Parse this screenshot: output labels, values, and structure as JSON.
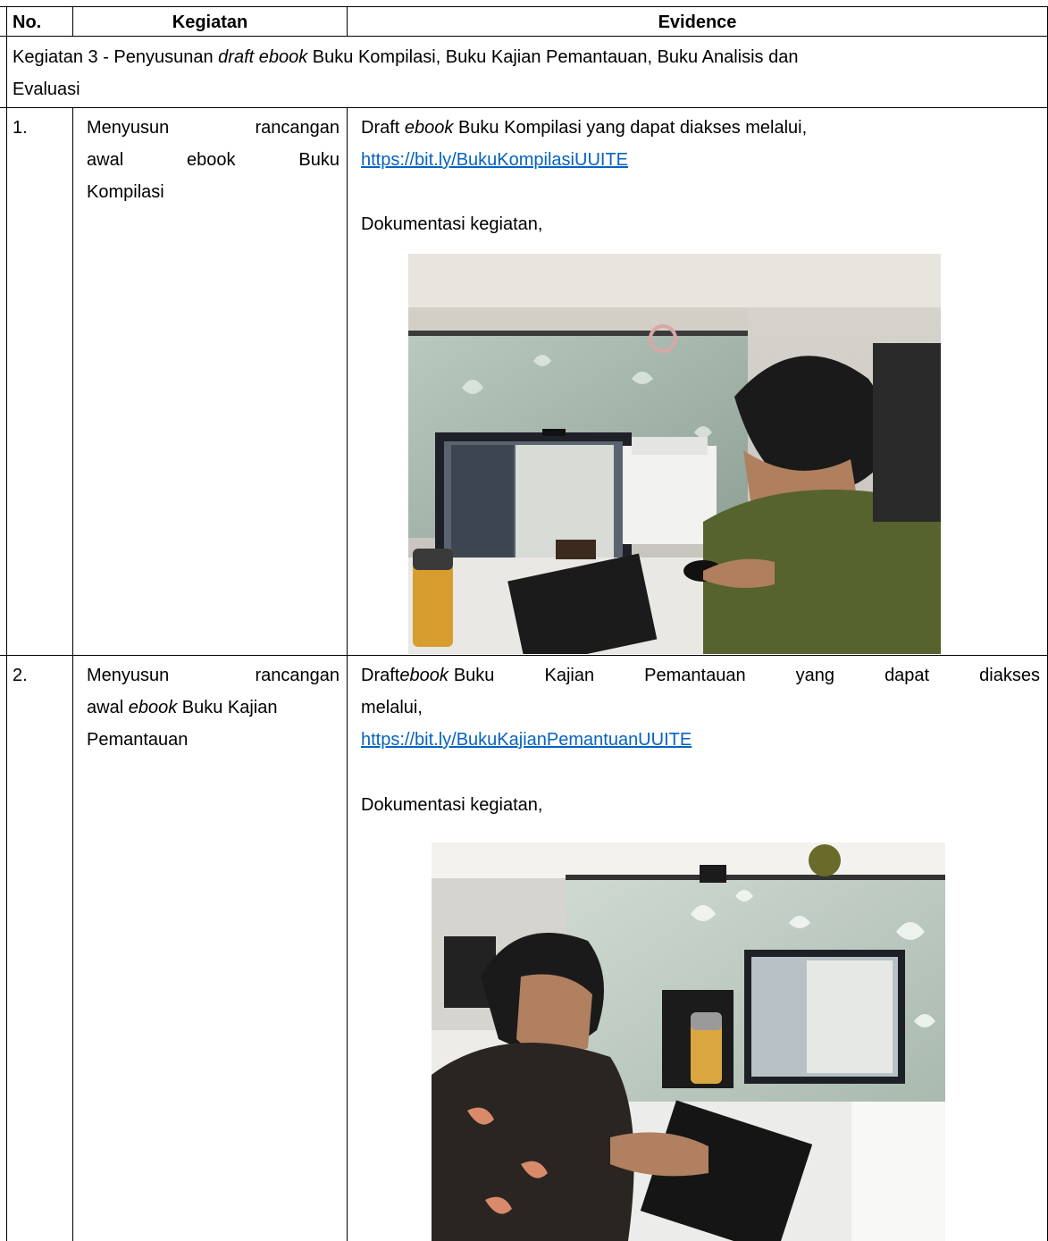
{
  "header": {
    "no": "No.",
    "kegiatan": "Kegiatan",
    "evidence": "Evidence"
  },
  "section": {
    "prefix": "Kegiatan 3 - Penyusunan ",
    "emphasis": "draft ebook",
    "suffix": " Buku Kompilasi, Buku Kajian Pemantauan, Buku Analisis dan",
    "line2": "Evaluasi"
  },
  "rows": [
    {
      "no": "1.",
      "kegiatan_lines": [
        "Menyusun rancangan",
        "awal ebook Buku",
        "Kompilasi"
      ],
      "evidence_prefix": "Draft ",
      "evidence_em": "ebook",
      "evidence_suffix": " Buku Kompilasi yang dapat diakses melalui,",
      "link": "https://bit.ly/BukuKompilasiUUITE",
      "doc_label": "Dokumentasi kegiatan,"
    },
    {
      "no": "2.",
      "kegiatan_line1": "Menyusun rancangan",
      "kegiatan_line2_a": "awal ",
      "kegiatan_line2_em": "ebook",
      "kegiatan_line2_b": " Buku Kajian",
      "kegiatan_line3": "Pemantauan",
      "evidence_line1_a": "Draft ",
      "evidence_line1_em": "ebook",
      "evidence_line1_b": " Buku Kajian Pemantauan yang dapat diakses",
      "evidence_line2": "melalui,",
      "link": "https://bit.ly/BukuKajianPemantuanUUITE",
      "doc_label": "Dokumentasi kegiatan,"
    }
  ],
  "colors": {
    "link": "#0563c1",
    "border": "#000000"
  }
}
